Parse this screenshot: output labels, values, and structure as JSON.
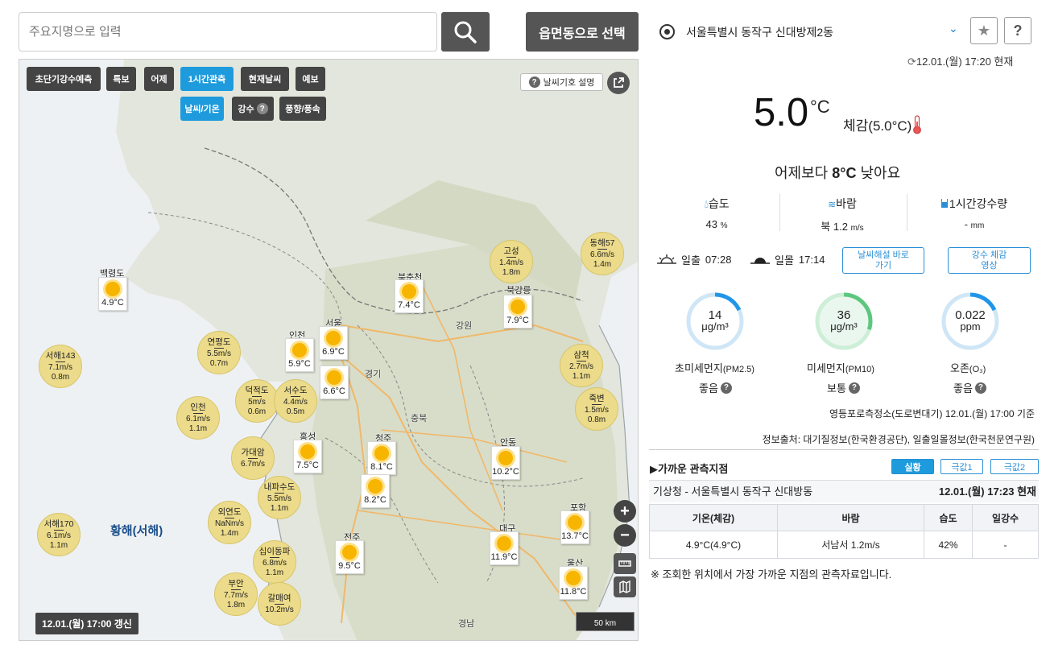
{
  "search": {
    "placeholder": "주요지명으로 입력",
    "emd_button": "읍면동으로 선택"
  },
  "map": {
    "tabs": [
      "초단기강수예측",
      "특보",
      "어제",
      "1시간관측",
      "현재날씨",
      "예보"
    ],
    "subtabs": [
      "날씨/기온",
      "강수",
      "풍향/풍속"
    ],
    "legend_button": "날씨기호 설명",
    "update_label": "12.01.(월) 17:00 갱신",
    "scale_label": "50 km",
    "sea_label": "황해(서해)",
    "regions": [
      "강원",
      "경기",
      "충북",
      "경남"
    ],
    "stations": [
      {
        "name": "백령도",
        "temp": "4.9°C"
      },
      {
        "name": "북춘천",
        "temp": "7.4°C"
      },
      {
        "name": "북강릉",
        "temp": "7.9°C"
      },
      {
        "name": "인천",
        "temp": "5.9°C"
      },
      {
        "name": "서울",
        "temp": "6.9°C"
      },
      {
        "name": "",
        "temp": "6.6°C"
      },
      {
        "name": "홍성",
        "temp": "7.5°C"
      },
      {
        "name": "청주",
        "temp": "8.1°C"
      },
      {
        "name": "",
        "temp": "8.2°C"
      },
      {
        "name": "안동",
        "temp": "10.2°C"
      },
      {
        "name": "포항",
        "temp": "13.7°C"
      },
      {
        "name": "대구",
        "temp": "11.9°C"
      },
      {
        "name": "전주",
        "temp": "9.5°C"
      },
      {
        "name": "울산",
        "temp": "11.8°C"
      }
    ],
    "winds": [
      {
        "name": "동해57",
        "speed": "6.6",
        "wave": "1.4"
      },
      {
        "name": "고성",
        "speed": "1.4",
        "wave": "1.8"
      },
      {
        "name": "서해143",
        "speed": "7.1",
        "wave": "0.8"
      },
      {
        "name": "연평도",
        "speed": "5.5",
        "wave": "0.7"
      },
      {
        "name": "삼척",
        "speed": "2.7",
        "wave": "1.1"
      },
      {
        "name": "덕적도",
        "speed": "5",
        "wave": "0.6"
      },
      {
        "name": "서수도",
        "speed": "4.4",
        "wave": "0.5"
      },
      {
        "name": "인천",
        "speed": "6.1",
        "wave": "1.1"
      },
      {
        "name": "죽변",
        "speed": "1.5",
        "wave": "0.8"
      },
      {
        "name": "가대암",
        "speed": "6.7",
        "wave": ""
      },
      {
        "name": "내파수도",
        "speed": "5.5",
        "wave": "1.1"
      },
      {
        "name": "외연도",
        "speed": "NaN",
        "wave": "1.4"
      },
      {
        "name": "서해170",
        "speed": "6.1",
        "wave": "1.1"
      },
      {
        "name": "십이동파",
        "speed": "6.8",
        "wave": "1.1"
      },
      {
        "name": "부안",
        "speed": "7.7",
        "wave": "1.8"
      },
      {
        "name": "갈매여",
        "speed": "10.2",
        "wave": ""
      }
    ]
  },
  "panel": {
    "location": "서울특별시 동작구 신대방제2동",
    "updated": "12.01.(월) 17:20 현재",
    "temp_value": "5.0",
    "temp_unit": "°C",
    "feels": "체감(5.0°C)",
    "compare_prefix": "어제보다 ",
    "compare_value": "8°C",
    "compare_suffix": " 낮아요",
    "humidity_label": "습도",
    "humidity_value": "43",
    "humidity_unit": "%",
    "wind_label": "바람",
    "wind_value": "북 1.2",
    "wind_unit": "m/s",
    "rain_label": "1시간강수량",
    "rain_value": "-",
    "rain_unit": "mm",
    "sunrise_label": "일출",
    "sunrise_time": "07:28",
    "sunset_label": "일몰",
    "sunset_time": "17:14",
    "btn_weather": "날씨해설 바로가기",
    "btn_rain": "강수 체감영상",
    "air": [
      {
        "value": "14",
        "unit": "μg/m³",
        "label": "초미세먼지",
        "sub": "(PM2.5)",
        "grade": "좋음",
        "fraction": 0.18,
        "color": "#2196e8"
      },
      {
        "value": "36",
        "unit": "μg/m³",
        "label": "미세먼지",
        "sub": "(PM10)",
        "grade": "보통",
        "fraction": 0.3,
        "color": "#5cc77e"
      },
      {
        "value": "0.022",
        "unit": "ppm",
        "label": "오존",
        "sub": "(O₃)",
        "grade": "좋음",
        "fraction": 0.18,
        "color": "#2196e8"
      }
    ],
    "air_source_station": "영등포로측정소(도로변대기) 12.01.(월) 17:00 기준",
    "info_source": "정보출처: 대기질정보(한국환경공단), 일출일몰정보(한국천문연구원)",
    "nearby_title": "▶가까운 관측지점",
    "nearby_tabs": [
      "실황",
      "극값1",
      "극값2"
    ],
    "obs_station": "기상청 - 서울특별시 동작구 신대방동",
    "obs_time": "12.01.(월) 17:23 현재",
    "table_headers": [
      "기온(체감)",
      "바람",
      "습도",
      "일강수"
    ],
    "table_row": [
      "4.9°C(4.9°C)",
      "서남서 1.2m/s",
      "42%",
      "-"
    ],
    "footnote": "※ 조회한 위치에서 가장 가까운 지점의 관측자료입니다."
  }
}
